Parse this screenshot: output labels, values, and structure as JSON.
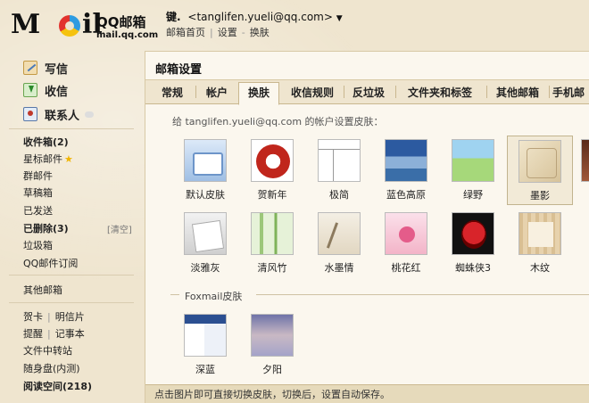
{
  "header": {
    "brand": "QQ邮箱",
    "domain": "mail.qq.com",
    "logo_text": "MoIl",
    "user_name": "键.",
    "user_email": "<tanglifen.yueli@qq.com>",
    "links": [
      "邮箱首页",
      "设置",
      "换肤"
    ]
  },
  "sidebar": {
    "actions": {
      "write": "写信",
      "receive": "收信",
      "contacts": "联系人"
    },
    "folders": {
      "inbox": "收件箱(2)",
      "starred": "星标邮件",
      "group": "群邮件",
      "drafts": "草稿箱",
      "sent": "已发送",
      "deleted": "已删除(3)",
      "clear": "[清空]",
      "spam": "垃圾箱",
      "subscriptions": "QQ邮件订阅",
      "other": "其他邮箱"
    },
    "tools": {
      "card": "贺卡",
      "postcard": "明信片",
      "reminder": "提醒",
      "notes": "记事本",
      "transfer": "文件中转站",
      "disk": "随身盘(内测)",
      "reading": "阅读空间(218)"
    }
  },
  "main": {
    "title": "邮箱设置",
    "tabs": [
      "常规",
      "帐户",
      "换肤",
      "收信规则",
      "反垃圾",
      "文件夹和标签",
      "其他邮箱",
      "手机邮"
    ],
    "active_tab": "换肤",
    "note": "给 tanglifen.yueli@qq.com 的帐户设置皮肤：",
    "skins_row1": [
      "默认皮肤",
      "贺新年",
      "极简",
      "蓝色高原",
      "绿野",
      "墨影"
    ],
    "skins_row2": [
      "淡雅灰",
      "清风竹",
      "水墨情",
      "桃花红",
      "蜘蛛侠3",
      "木纹"
    ],
    "selected_skin": "墨影",
    "foxmail_section": "Foxmail皮肤",
    "foxmail_skins": [
      "深蓝",
      "夕阳"
    ],
    "status": "点击图片即可直接切换皮肤，切换后，设置自动保存。"
  },
  "colors": {
    "background": "#efe5cf",
    "panel": "#fbf7ee",
    "border": "#d8c9a6",
    "star": "#f0b400"
  }
}
